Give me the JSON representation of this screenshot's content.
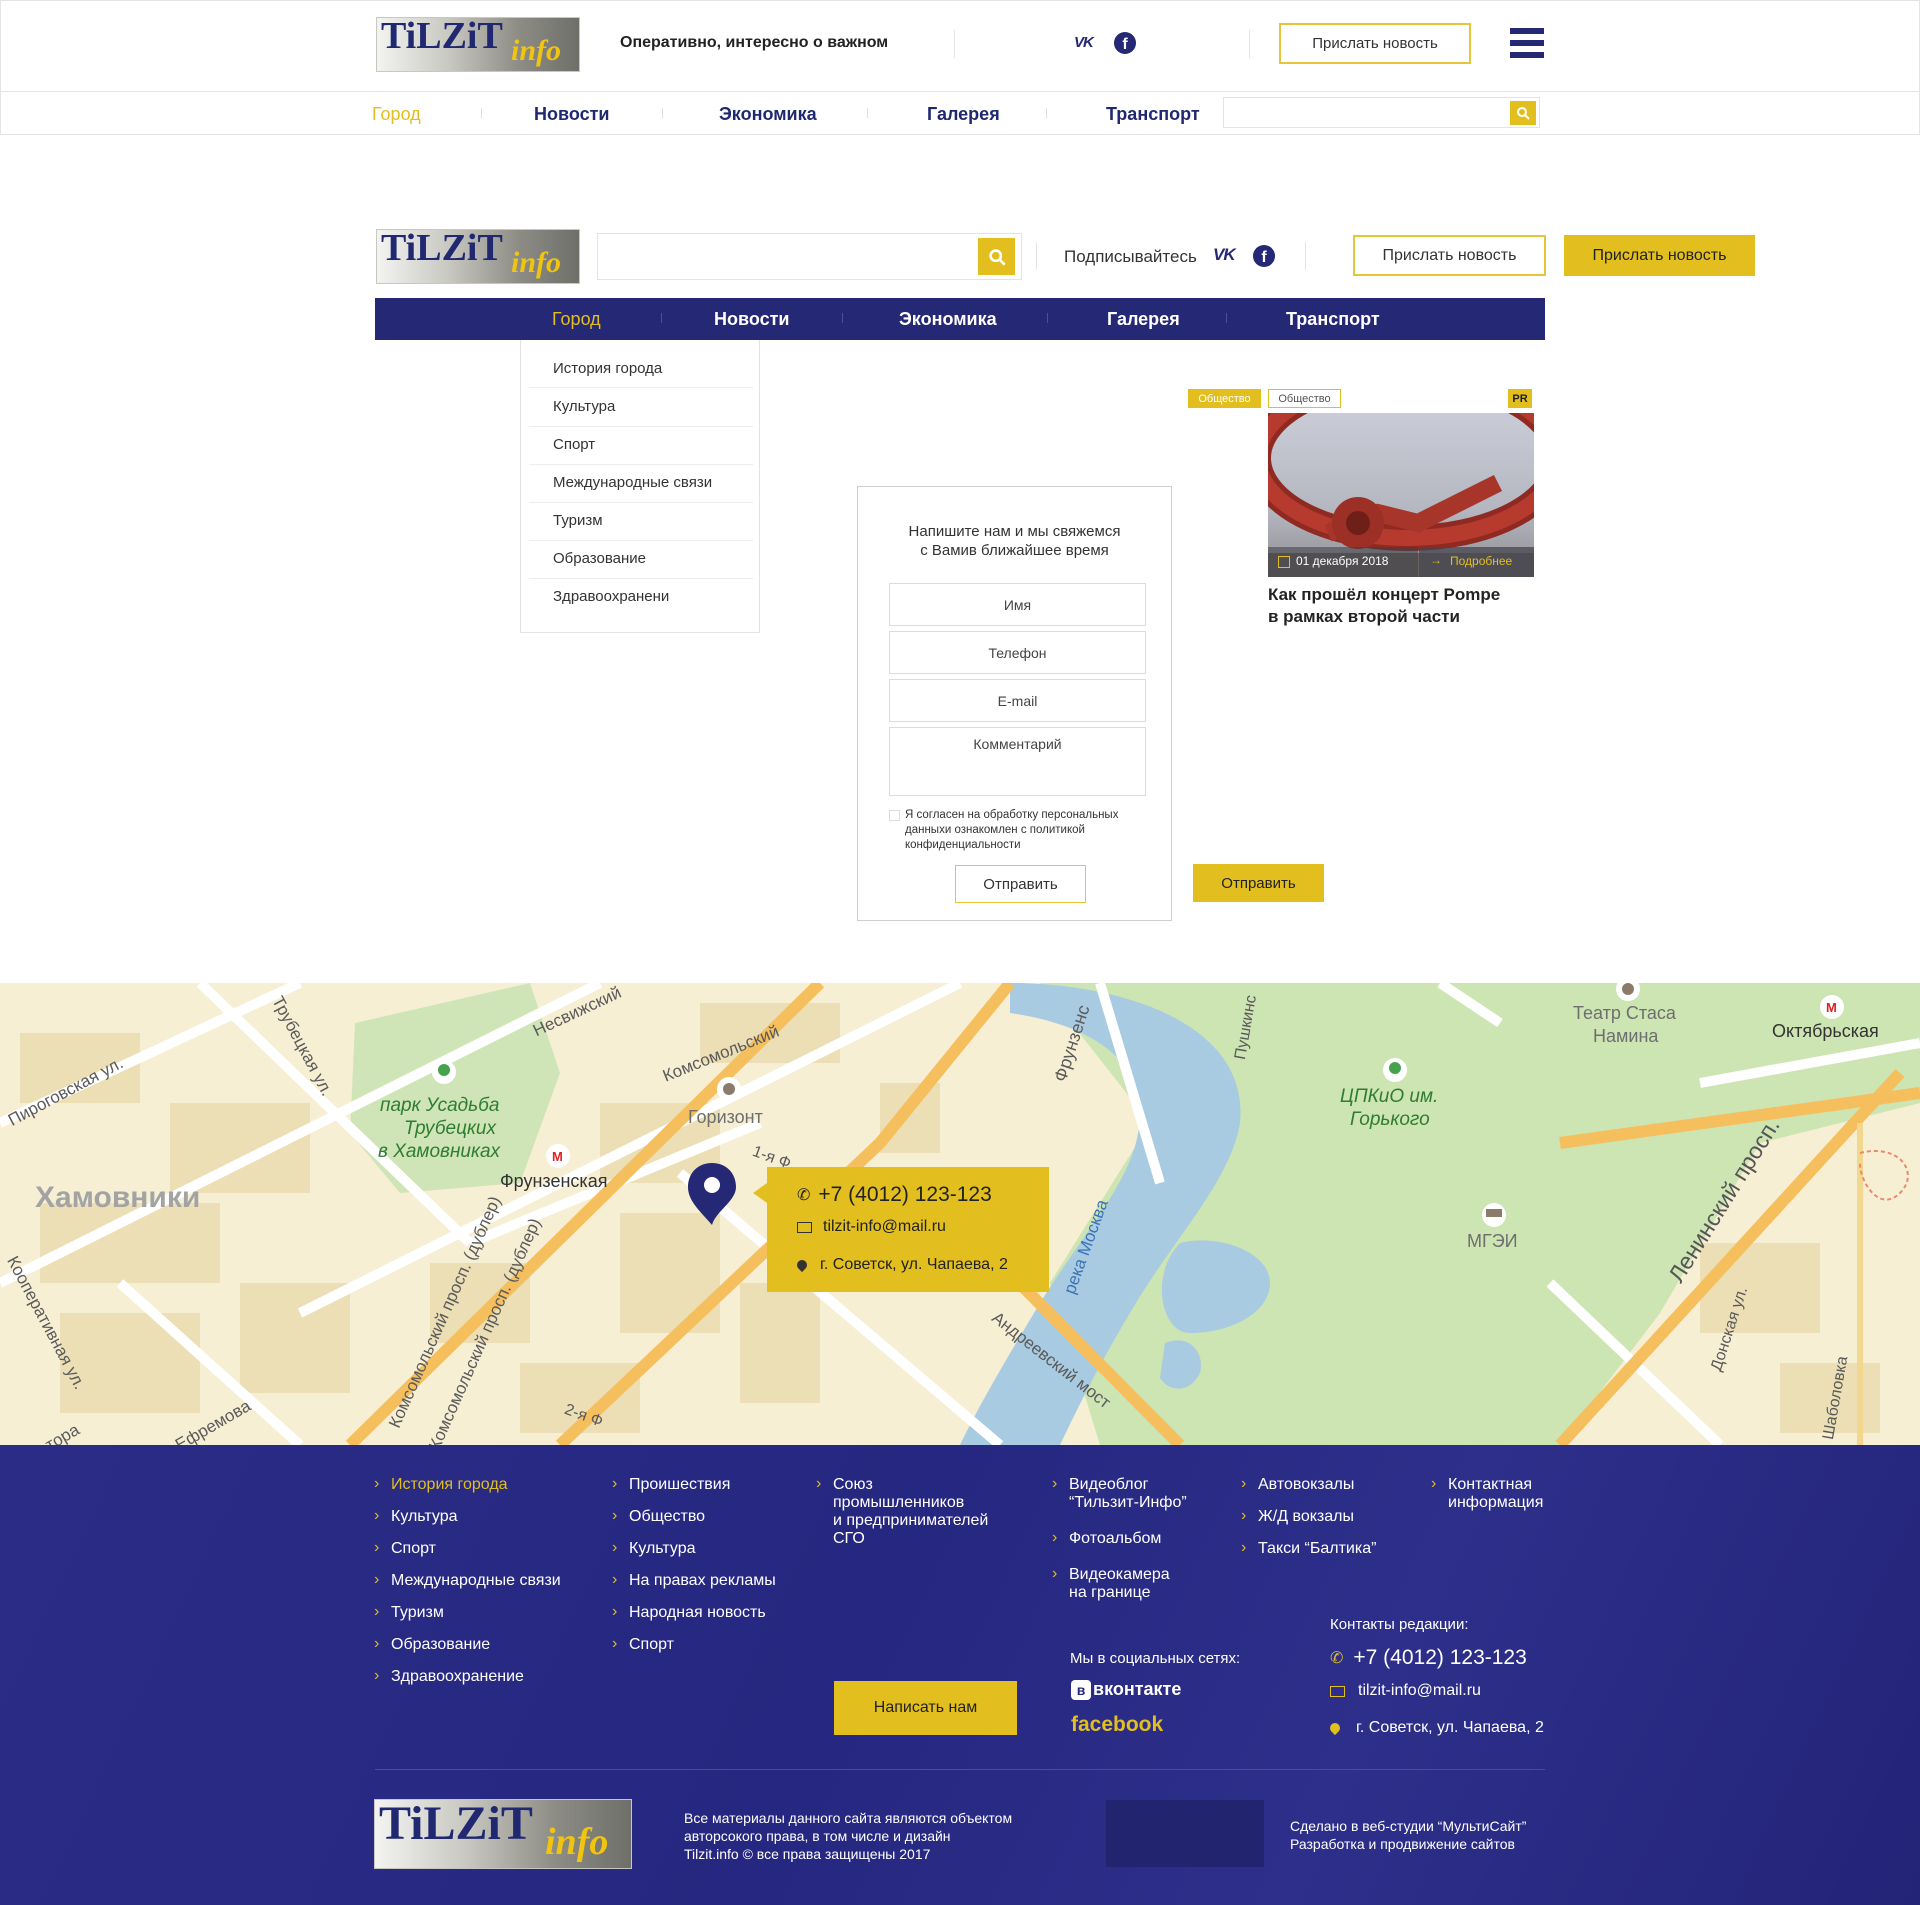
{
  "header1": {
    "logo_main": "TiLZiT",
    "logo_sub": "info",
    "tagline": "Оперативно, интересно о важном",
    "send_news": "Прислать новость",
    "nav": [
      "Город",
      "Новости",
      "Экономика",
      "Галерея",
      "Транспорт"
    ]
  },
  "header2": {
    "logo_main": "TiLZiT",
    "logo_sub": "info",
    "subscribe": "Подписывайтесь",
    "send_news_outline": "Прислать новость",
    "send_news_filled": "Прислать новость",
    "nav": [
      "Город",
      "Новости",
      "Экономика",
      "Галерея",
      "Транспорт"
    ],
    "submenu": [
      "История города",
      "Культура",
      "Спорт",
      "Международные связи",
      "Туризм",
      "Образование",
      "Здравоохранени"
    ]
  },
  "form": {
    "title_line1": "Напишите нам и мы свяжемся",
    "title_line2": "с Вамив ближайшее время",
    "name_placeholder": "Имя",
    "phone_placeholder": "Телефон",
    "email_placeholder": "E-mail",
    "comment_placeholder": "Комментарий",
    "consent_line1": "Я согласен на обработку персональных",
    "consent_line2": "данныхи ознакомлен с политикой",
    "consent_line3": "конфиденциальности",
    "submit_outline": "Отправить",
    "submit_filled": "Отправить"
  },
  "news_card": {
    "tag1": "Общество",
    "tag2": "Общество",
    "pr_badge": "PR",
    "date": "01 декабря 2018",
    "more": "Подробнее",
    "title_line1": "Как прошёл концерт Pompe",
    "title_line2": "в рамках второй части"
  },
  "map": {
    "labels": {
      "nesvizhsky": "Несвижский",
      "komsomolsky": "Комсомольский",
      "trubetskaya": "Трубецкая ул.",
      "pirogovskaya": "Пироговская ул.",
      "park_line1": "парк Усадьба",
      "park_line2": "Трубецких",
      "park_line3": "в Хамовниках",
      "khamovniki": "Хамовники",
      "frunzenskaya_metro": "Фрунзенская",
      "horizont": "Горизонт",
      "first_street": "1-я Ф",
      "frunzenskaya_emb": "Фрунзенс",
      "pushkinskaya": "Пушкинс",
      "reka": "река Москва",
      "andreevsky": "Андреевский мост",
      "cpkio_line1": "ЦПКиО им.",
      "cpkio_line2": "Горького",
      "teatr_line1": "Театр Стаса",
      "teatr_line2": "Намина",
      "oktyabrskaya": "Октябрьская",
      "leninsky": "Ленинский просп.",
      "mgei": "МГЭИ",
      "donskaya": "Донская ул.",
      "shabolovka": "Шаболовка",
      "kooperativnaya": "Кооперативная ул.",
      "komsomolsky_dubler1": "Комсомольский просп. (дублер)",
      "komsomolsky_dubler2": "Комсомольский просп. (дублер)",
      "efremova": "Ефремова",
      "tora": "тора",
      "second_street": "2-я Ф"
    },
    "popup": {
      "phone": "+7 (4012) 123-123",
      "email": "tilzit-info@mail.ru",
      "address": "г. Советск, ул. Чапаева, 2"
    }
  },
  "footer": {
    "col1": [
      "История города",
      "Культура",
      "Спорт",
      "Международные связи",
      "Туризм",
      "Образование",
      "Здравоохранение"
    ],
    "col2": [
      "Проишествия",
      "Общество",
      "Культура",
      "На правах рекламы",
      "Народная новость",
      "Спорт"
    ],
    "col3_line1": "Союз",
    "col3_line2": "промышленников",
    "col3_line3": "и предпринимателей",
    "col3_line4": "СГО",
    "col4": [
      {
        "line1": "Видеоблог",
        "line2": "“Тильзит-Инфо”"
      },
      {
        "line1": "Фотоальбом",
        "line2": ""
      },
      {
        "line1": "Видеокамера",
        "line2": "на границе"
      }
    ],
    "col5": [
      "Автовокзалы",
      "Ж/Д вокзалы",
      "Такси “Балтика”"
    ],
    "col6_line1": "Контактная",
    "col6_line2": "информация",
    "write_us": "Написать нам",
    "social_title": "Мы в социальных сетях:",
    "vk_label": "вконтакте",
    "fb_label": "facebook",
    "contacts_title": "Контакты редакции:",
    "phone": "+7 (4012) 123-123",
    "email": "tilzit-info@mail.ru",
    "address": "г. Советск, ул. Чапаева, 2",
    "logo_main": "TiLZiT",
    "logo_sub": "info",
    "copyright_line1": "Все материалы данного сайта являются объектом",
    "copyright_line2": "авторсокого права, в том числе и дизайн",
    "copyright_line3": "Tilzit.info © все права защищены 2017",
    "studio_line1": "Сделано в веб-студии “МультиСайт”",
    "studio_line2": "Разработка и продвижение сайтов"
  },
  "colors": {
    "accent_yellow": "#e2bf1f",
    "brand_navy": "#252874",
    "footer_bg": "#2a2a82"
  }
}
